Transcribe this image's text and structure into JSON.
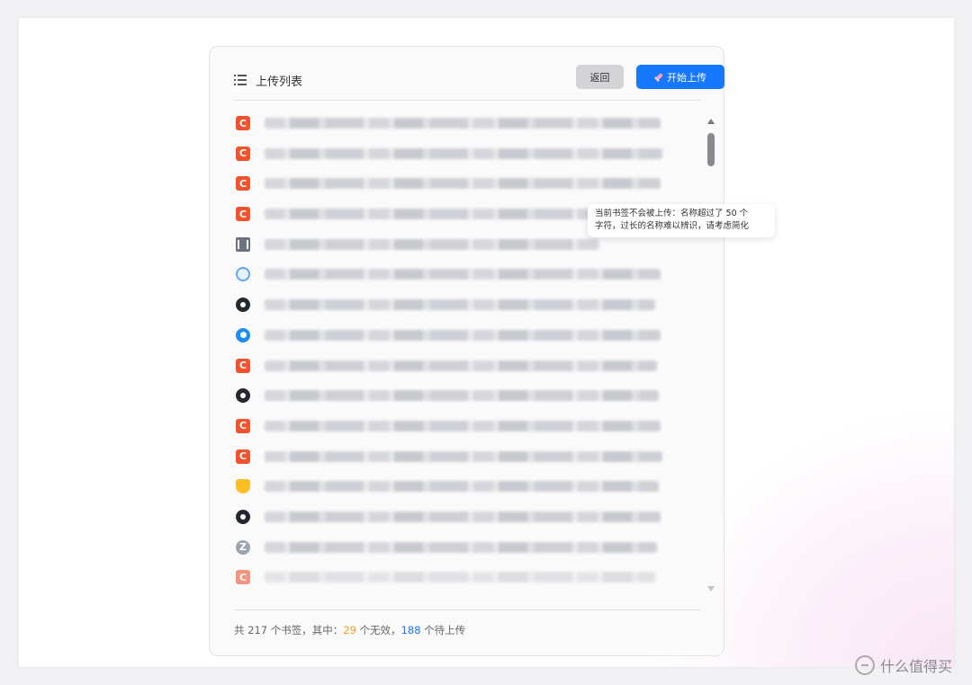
{
  "header": {
    "title": "上传列表",
    "back_label": "返回",
    "start_label": "开始上传"
  },
  "list": {
    "rows": [
      {
        "icon": "csdn-favicon-icon"
      },
      {
        "icon": "csdn-favicon-icon"
      },
      {
        "icon": "csdn-favicon-icon"
      },
      {
        "icon": "csdn-favicon-icon"
      },
      {
        "icon": "book-favicon-icon"
      },
      {
        "icon": "globe-favicon-icon"
      },
      {
        "icon": "github-favicon-icon"
      },
      {
        "icon": "blue-circle-favicon-icon"
      },
      {
        "icon": "csdn-favicon-icon"
      },
      {
        "icon": "github-favicon-icon"
      },
      {
        "icon": "csdn-favicon-icon"
      },
      {
        "icon": "csdn-favicon-icon"
      },
      {
        "icon": "trophy-favicon-icon"
      },
      {
        "icon": "github-favicon-icon"
      },
      {
        "icon": "z-favicon-icon"
      },
      {
        "icon": "csdn-favicon-icon"
      }
    ]
  },
  "tooltip": {
    "line1": "当前书签不会被上传：名称超过了 50 个",
    "line2": "字符，过长的名称难以辨识，请考虑简化"
  },
  "footer": {
    "prefix": "共 217 个书签，其中：",
    "invalid_count": "29",
    "invalid_suffix": " 个无效，",
    "pending_count": "188",
    "pending_suffix": " 个待上传"
  },
  "watermark": {
    "text": "什么值得买"
  },
  "colors": {
    "primary": "#1677ff",
    "warning": "#f2b233",
    "invalid": "#f0a020",
    "csdn": "#f0532d"
  }
}
